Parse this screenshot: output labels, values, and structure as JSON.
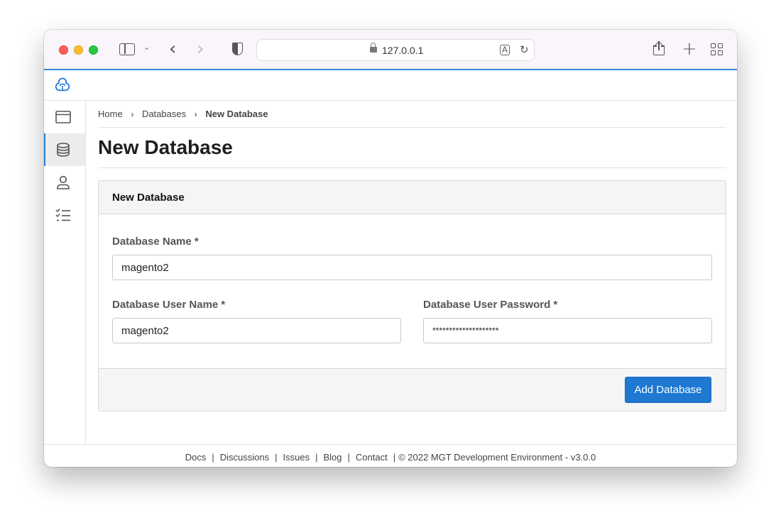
{
  "browser": {
    "url": "127.0.0.1",
    "icons": [
      "sidebar-icon",
      "chevron-down-icon",
      "back-icon",
      "forward-icon",
      "shield-icon",
      "lock-icon",
      "translate-icon",
      "reload-icon",
      "share-icon",
      "new-tab-icon",
      "tab-overview-icon"
    ]
  },
  "sidebar": {
    "items": [
      {
        "name": "window",
        "icon": "browser-window-icon",
        "active": false
      },
      {
        "name": "databases",
        "icon": "database-icon",
        "active": true
      },
      {
        "name": "users",
        "icon": "user-icon",
        "active": false
      },
      {
        "name": "tasks",
        "icon": "checklist-icon",
        "active": false
      }
    ]
  },
  "breadcrumb": {
    "items": [
      "Home",
      "Databases"
    ],
    "current": "New Database"
  },
  "page": {
    "title": "New Database"
  },
  "form": {
    "header": "New Database",
    "db_name_label": "Database Name *",
    "db_name_value": "magento2",
    "db_user_label": "Database User Name *",
    "db_user_value": "magento2",
    "db_password_label": "Database User Password *",
    "db_password_value": "********************",
    "submit_label": "Add Database"
  },
  "footer": {
    "links": [
      "Docs",
      "Discussions",
      "Issues",
      "Blog",
      "Contact"
    ],
    "copyright": "© 2022  MGT Development Environment  - v3.0.0"
  },
  "colors": {
    "accent": "#1f78d1",
    "active_nav_border": "#2d7fd6"
  }
}
